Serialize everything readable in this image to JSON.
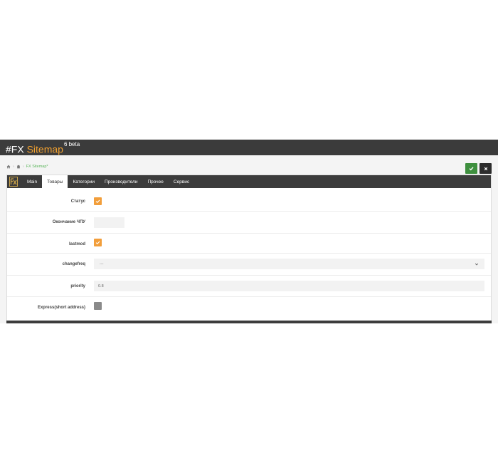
{
  "header": {
    "title_prefix": "#FX ",
    "title_brand": "Sitemap",
    "title_version": "6 beta"
  },
  "breadcrumb": {
    "items": [
      "home-icon",
      "extensions-icon"
    ],
    "current": "FX Sitemap*"
  },
  "actions": {
    "save_icon": "check-icon",
    "close_icon": "close-icon",
    "save_color": "#3e8f3e",
    "close_color": "#2d2d2d"
  },
  "tabs": [
    {
      "label": "Main",
      "active": false
    },
    {
      "label": "Товары",
      "active": true
    },
    {
      "label": "Категории",
      "active": false
    },
    {
      "label": "Производители",
      "active": false
    },
    {
      "label": "Прочее",
      "active": false
    },
    {
      "label": "Сервис",
      "active": false
    }
  ],
  "form": {
    "status": {
      "label": "Статус",
      "checked": true
    },
    "url_ending": {
      "label": "Окончание ЧПУ",
      "value": ""
    },
    "lastmod": {
      "label": "lastmod",
      "checked": true
    },
    "changefreq": {
      "label": "changefreq",
      "value": "---"
    },
    "priority": {
      "label": "priority",
      "value": "0.8"
    },
    "express": {
      "label": "Express(short address)",
      "checked": false
    }
  },
  "colors": {
    "accent": "#f0a030",
    "header_bg": "#3b3b3b",
    "checkbox_on": "#f29e3b",
    "checkbox_off": "#8a8a8a",
    "breadcrumb_link": "#5bb55b"
  }
}
